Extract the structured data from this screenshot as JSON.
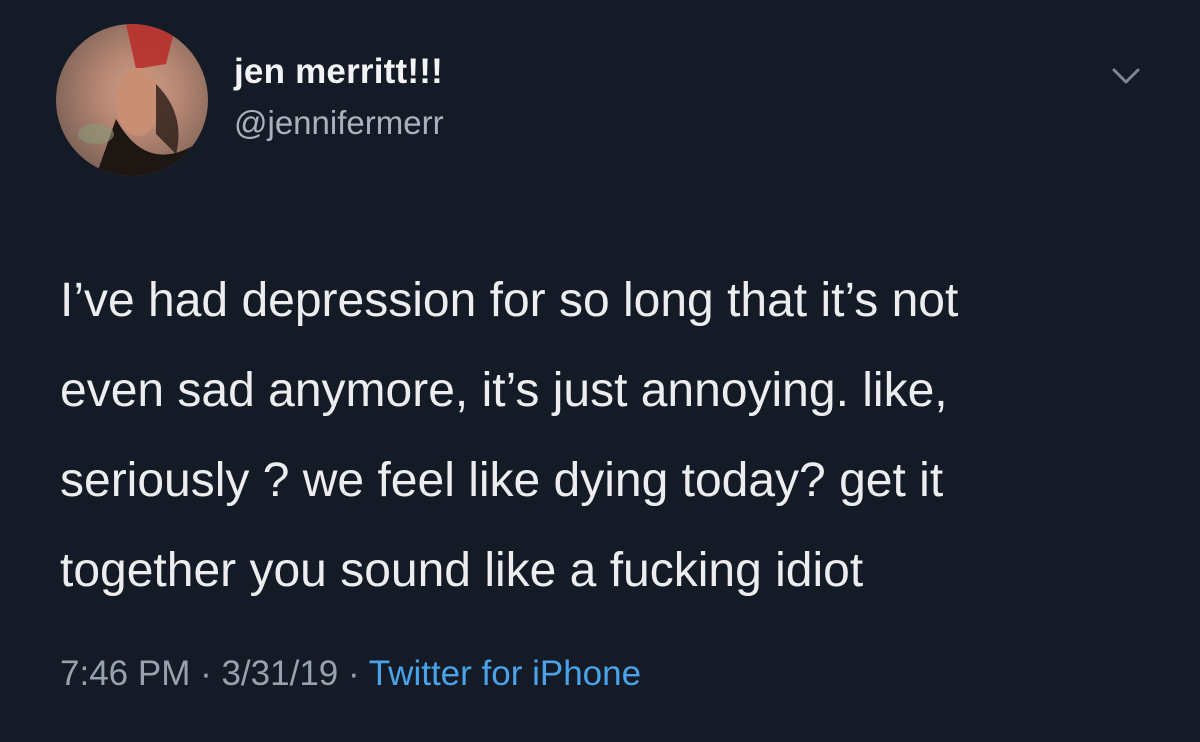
{
  "author": {
    "display_name": "jen merritt!!!",
    "handle": "@jennifermerr"
  },
  "tweet": {
    "lines": [
      "I’ve had depression for so long that it’s not",
      "even sad anymore, it’s just annoying. like,",
      "seriously ? we feel like dying today? get it",
      "together you sound like a fucking idiot"
    ]
  },
  "meta": {
    "time": "7:46 PM",
    "separator": " · ",
    "date": "3/31/19",
    "source": "Twitter for iPhone"
  },
  "icons": {
    "menu": "chevron-down-icon",
    "avatar": "avatar"
  },
  "colors": {
    "background": "#151b26",
    "text": "#ecedef",
    "muted": "#97a2ad",
    "link": "#4aa3e8"
  }
}
